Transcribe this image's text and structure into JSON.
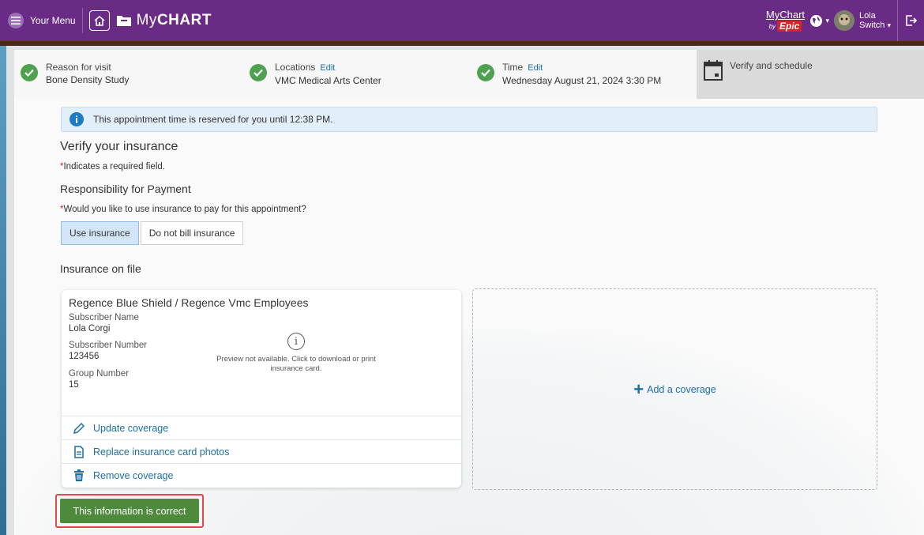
{
  "header": {
    "menu_label": "Your Menu",
    "logo_prefix": "My",
    "logo_suffix": "CHART",
    "epic_top": "MyChart",
    "epic_by": "by",
    "epic_word": "Epic",
    "user_first": "Lola",
    "user_second": "Switch",
    "menu_icon": "hamburger-icon",
    "home_icon": "home-icon",
    "globe_icon": "globe-icon",
    "logout_icon": "logout-icon",
    "brand_color": "#6a2b86"
  },
  "steps": [
    {
      "label": "Reason for visit",
      "edit": "",
      "value": "Bone Density Study"
    },
    {
      "label": "Locations",
      "edit": "Edit",
      "value": "VMC Medical Arts Center"
    },
    {
      "label": "Time",
      "edit": "Edit",
      "value": "Wednesday August 21, 2024 3:30 PM"
    },
    {
      "label": "Verify and schedule",
      "edit": "",
      "value": ""
    }
  ],
  "banner": {
    "text": "This appointment time is reserved for you until 12:38 PM.",
    "icon": "info-icon"
  },
  "form": {
    "heading": "Verify your insurance",
    "required_star": "*",
    "required_note": "Indicates a required field.",
    "responsibility_heading": "Responsibility for Payment",
    "question": "Would you like to use insurance to pay for this appointment?",
    "options": [
      "Use insurance",
      "Do not bill insurance"
    ],
    "selected_option": "Use insurance"
  },
  "insurance": {
    "section_label": "Insurance on file",
    "card": {
      "title": "Regence Blue Shield / Regence Vmc Employees",
      "subscriber_name_label": "Subscriber Name",
      "subscriber_name": "Lola Corgi",
      "subscriber_number_label": "Subscriber Number",
      "subscriber_number": "123456",
      "group_number_label": "Group Number",
      "group_number": "15",
      "preview_text": "Preview not available. Click to download or print insurance card."
    },
    "actions": [
      {
        "label": "Update coverage",
        "icon": "pencil-icon"
      },
      {
        "label": "Replace insurance card photos",
        "icon": "document-icon"
      },
      {
        "label": "Remove coverage",
        "icon": "trash-icon"
      }
    ],
    "add_coverage_label": "Add a coverage"
  },
  "confirm_button_label": "This information is correct",
  "colors": {
    "accent_green": "#4d8a3c",
    "link_blue": "#1c6ea4",
    "highlight_red": "#e24a4a"
  }
}
